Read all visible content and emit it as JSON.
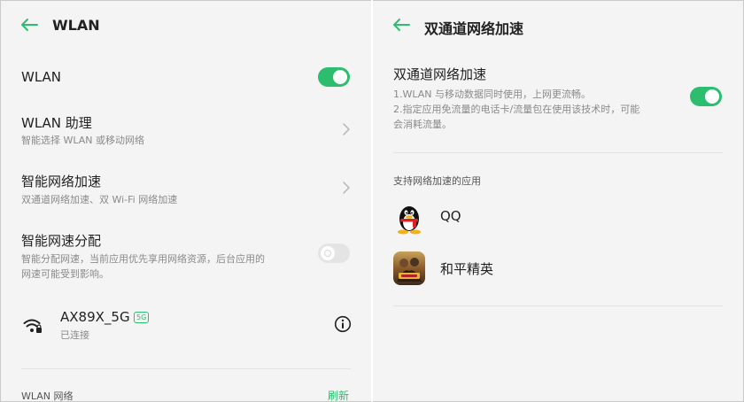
{
  "colors": {
    "accent": "#2cbd6e",
    "background": "#f4f4f4"
  },
  "left": {
    "header": {
      "back_icon": "arrow-left-icon",
      "title": "WLAN"
    },
    "wlan_toggle": {
      "label": "WLAN",
      "state": "on"
    },
    "assistant": {
      "title": "WLAN 助理",
      "subtitle": "智能选择 WLAN 或移动网络"
    },
    "smart_accel": {
      "title": "智能网络加速",
      "subtitle": "双通道网络加速、双 Wi-Fi 网络加速"
    },
    "speed_alloc": {
      "title": "智能网速分配",
      "subtitle_line1": "智能分配网速，当前应用优先享用网络资源，后台应用的",
      "subtitle_line2": "网速可能受到影响。",
      "state": "off"
    },
    "connected": {
      "icon": "wifi-lock-icon",
      "ssid": "AX89X_5G",
      "badge": "5G",
      "status": "已连接",
      "info_icon": "info-icon"
    },
    "networks_section": {
      "label": "WLAN 网络",
      "refresh": "刷新"
    }
  },
  "right": {
    "header": {
      "back_icon": "arrow-left-icon",
      "title": "双通道网络加速"
    },
    "dual_channel": {
      "title": "双通道网络加速",
      "desc_line1": "1.WLAN 与移动数据同时使用，上网更流畅。",
      "desc_line2": "2.指定应用免流量的电话卡/流量包在使用该技术时，可能",
      "desc_line3": "会消耗流量。",
      "state": "on"
    },
    "apps_section": {
      "label": "支持网络加速的应用"
    },
    "apps": [
      {
        "name": "QQ",
        "icon": "qq-penguin-icon"
      },
      {
        "name": "和平精英",
        "icon": "game-app-icon"
      }
    ]
  }
}
